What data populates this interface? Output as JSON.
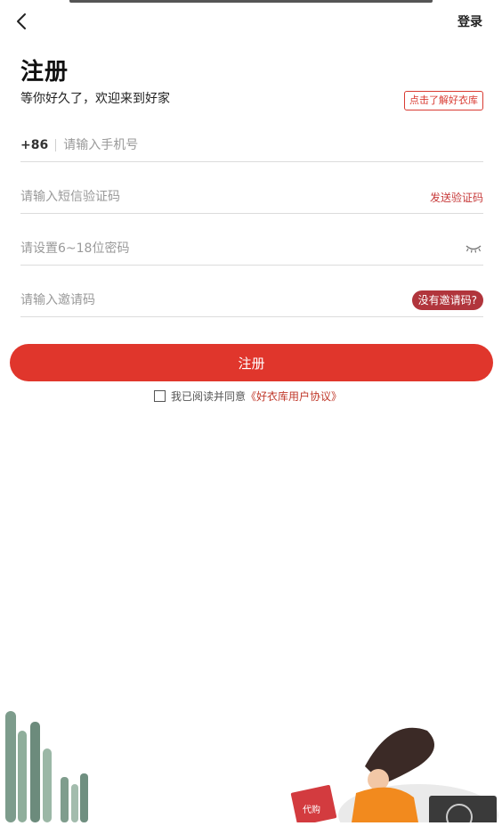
{
  "header": {
    "back_icon": "chevron-left-icon",
    "login_label": "登录"
  },
  "page": {
    "title": "注册",
    "subtitle": "等你好久了，欢迎来到好家",
    "learn_more_label": "点击了解好衣库"
  },
  "form": {
    "phone": {
      "country_code": "+86",
      "placeholder": "请输入手机号",
      "value": ""
    },
    "sms_code": {
      "placeholder": "请输入短信验证码",
      "value": "",
      "send_label": "发送验证码"
    },
    "password": {
      "placeholder": "请设置6~18位密码",
      "value": "",
      "toggle_icon": "eye-closed-icon"
    },
    "invite_code": {
      "placeholder": "请输入邀请码",
      "value": "",
      "help_label": "没有邀请码?"
    },
    "submit_label": "注册",
    "agreement": {
      "checked": false,
      "prefix": "我已阅读并同意",
      "link_label": "《好衣库用户协议》"
    }
  },
  "illustration": {
    "bag_label": "代购",
    "icons": [
      "cactus-icon",
      "shopping-woman-icon",
      "floating-action-icon"
    ]
  },
  "colors": {
    "accent": "#e0362c",
    "accent_dark": "#b1353c",
    "link": "#c0392b",
    "text": "#222222",
    "placeholder": "#9a9a9a"
  }
}
